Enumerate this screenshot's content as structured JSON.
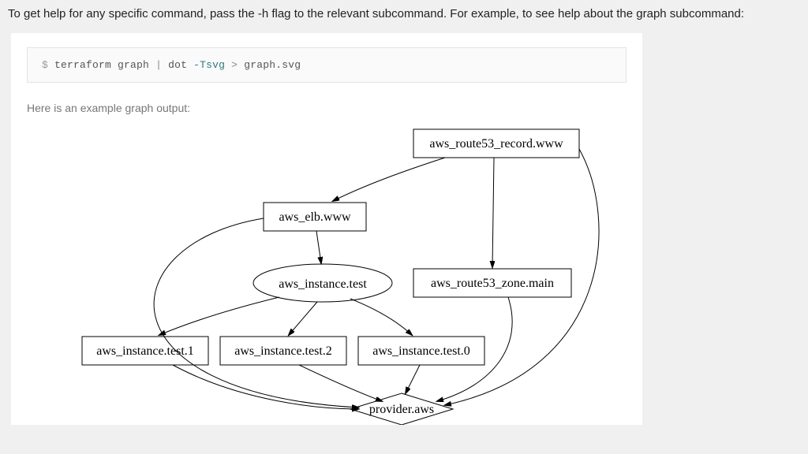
{
  "intro": "To get help for any specific command, pass the -h flag to the relevant subcommand. For example, to see help about the graph subcommand:",
  "code": {
    "prompt": "$",
    "part1": "terraform graph",
    "pipe": "|",
    "part2": "dot",
    "flag": "-Tsvg",
    "gt": ">",
    "out": "graph.svg"
  },
  "caption": "Here is an example graph output:",
  "graph": {
    "nodes": {
      "route53_record": "aws_route53_record.www",
      "elb": "aws_elb.www",
      "instance": "aws_instance.test",
      "route53_zone": "aws_route53_zone.main",
      "inst1": "aws_instance.test.1",
      "inst2": "aws_instance.test.2",
      "inst0": "aws_instance.test.0",
      "provider": "provider.aws"
    }
  }
}
